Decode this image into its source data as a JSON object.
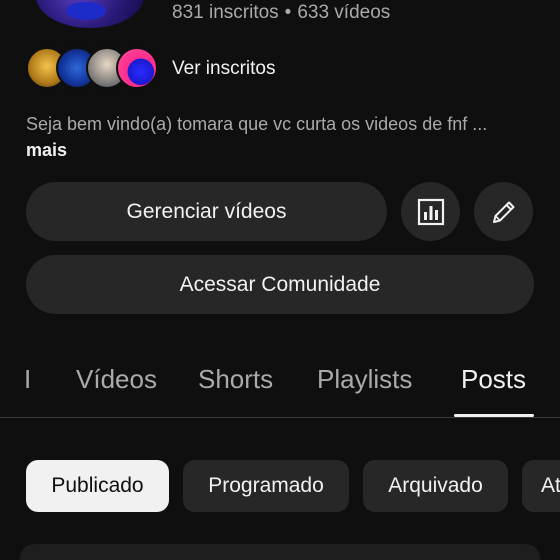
{
  "channel": {
    "subscribers": "831 inscritos",
    "separator": "•",
    "videos": "633 vídeos",
    "view_subscribers": "Ver inscritos",
    "description": "Seja bem vindo(a) tomara que vc curta os videos de fnf ...",
    "more": "mais"
  },
  "actions": {
    "manage_videos": "Gerenciar vídeos",
    "access_community": "Acessar Comunidade",
    "analytics_icon": "analytics-icon",
    "edit_icon": "pencil-icon"
  },
  "tabs": [
    {
      "label": "I"
    },
    {
      "label": "Vídeos"
    },
    {
      "label": "Shorts"
    },
    {
      "label": "Playlists"
    },
    {
      "label": "Posts",
      "selected": true
    }
  ],
  "filters": [
    {
      "label": "Publicado",
      "selected": true
    },
    {
      "label": "Programado"
    },
    {
      "label": "Arquivado"
    },
    {
      "label": "At"
    }
  ],
  "colors": {
    "background": "#0f0f0f",
    "surface": "#272727",
    "text_primary": "#f1f1f1",
    "text_secondary": "#aaaaaa"
  }
}
